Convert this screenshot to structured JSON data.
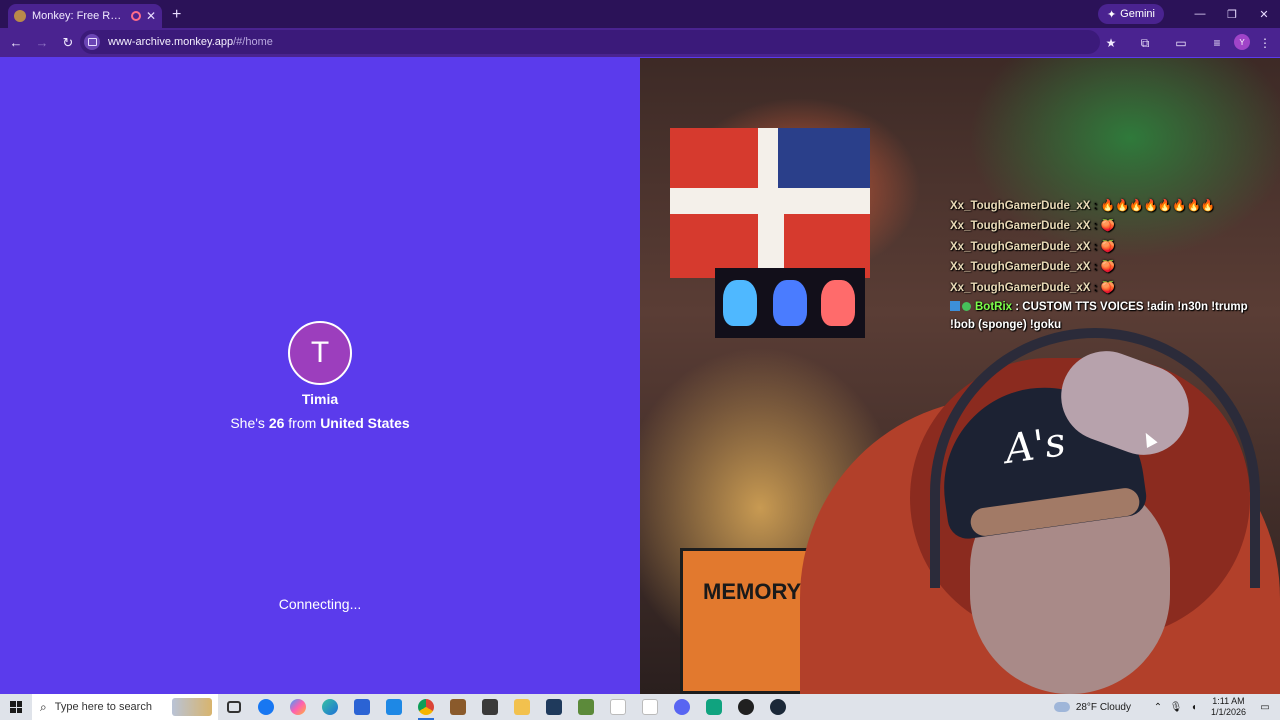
{
  "browser": {
    "tab_title": "Monkey: Free Random Video Chat",
    "new_tab_label": "+",
    "gemini_label": "Gemini",
    "url_host": "www-archive.monkey.app",
    "url_path": "/#/home",
    "profile_initial": "Y"
  },
  "left_pane": {
    "avatar_letter": "T",
    "name": "Timia",
    "info_prefix": "She's",
    "age": "26",
    "info_mid": "from",
    "country": "United States",
    "status": "Connecting..."
  },
  "video": {
    "sign_text": "MEMORY",
    "chat": [
      {
        "user": "Xx_ToughGamerDude_xX",
        "msg": "🔥🔥🔥🔥🔥🔥🔥🔥"
      },
      {
        "user": "Xx_ToughGamerDude_xX",
        "msg": "🍑"
      },
      {
        "user": "Xx_ToughGamerDude_xX",
        "msg": "🍑"
      },
      {
        "user": "Xx_ToughGamerDude_xX",
        "msg": "🍑"
      },
      {
        "user": "Xx_ToughGamerDude_xX",
        "msg": "🍑"
      }
    ],
    "bot": {
      "name": "BotRix",
      "msg": "CUSTOM TTS VOICES !adin !n30n !trump !bob (sponge) !goku"
    }
  },
  "taskbar": {
    "search_placeholder": "Type here to search",
    "weather": "28°F  Cloudy",
    "time": "1:11 AM",
    "date": "1/1/2026"
  },
  "colors": {
    "left_background": "#5b3bec",
    "avatar": "#9c3ebd",
    "browser_frame": "#2b1258",
    "toolbar": "#4a2390"
  }
}
